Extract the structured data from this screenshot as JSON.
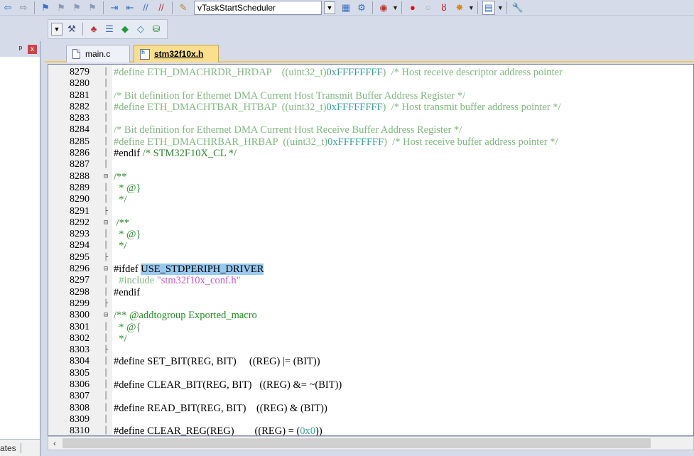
{
  "toolbar_top": {
    "function_combo": "vTaskStartScheduler"
  },
  "left_panel": {
    "pin_glyph": "ᵖ",
    "close_glyph": "x",
    "footer_label": "ates"
  },
  "tabs": [
    {
      "label": "main.c"
    },
    {
      "label": "stm32f10x.h"
    }
  ],
  "code_lines": [
    {
      "n": "8279",
      "fold": "│",
      "code": "#define ETH_DMACHRDR_HRDAP    ((uint32_t)0xFFFFFFFF)  /* Host receive descriptor address pointer"
    },
    {
      "n": "8280",
      "fold": "│",
      "code": ""
    },
    {
      "n": "8281",
      "fold": "│",
      "code": "/* Bit definition for Ethernet DMA Current Host Transmit Buffer Address Register */"
    },
    {
      "n": "8282",
      "fold": "│",
      "code": "#define ETH_DMACHTBAR_HTBAP  ((uint32_t)0xFFFFFFFF)  /* Host transmit buffer address pointer */"
    },
    {
      "n": "8283",
      "fold": "│",
      "code": ""
    },
    {
      "n": "8284",
      "fold": "│",
      "code": "/* Bit definition for Ethernet DMA Current Host Receive Buffer Address Register */"
    },
    {
      "n": "8285",
      "fold": "│",
      "code": "#define ETH_DMACHRBAR_HRBAP  ((uint32_t)0xFFFFFFFF)  /* Host receive buffer address pointer */"
    },
    {
      "n": "8286",
      "fold": "│",
      "code": "#endif /* STM32F10X_CL */"
    },
    {
      "n": "8287",
      "fold": "│",
      "code": ""
    },
    {
      "n": "8288",
      "fold": "⊟",
      "code": "/**"
    },
    {
      "n": "8289",
      "fold": "│",
      "code": "  * @}"
    },
    {
      "n": "8290",
      "fold": "│",
      "code": "  */"
    },
    {
      "n": "8291",
      "fold": "├",
      "code": ""
    },
    {
      "n": "8292",
      "fold": "⊟",
      "code": " /**"
    },
    {
      "n": "8293",
      "fold": "│",
      "code": "  * @}"
    },
    {
      "n": "8294",
      "fold": "│",
      "code": "  */"
    },
    {
      "n": "8295",
      "fold": "├",
      "code": ""
    },
    {
      "n": "8296",
      "fold": "⊟",
      "code": "#ifdef USE_STDPERIPH_DRIVER"
    },
    {
      "n": "8297",
      "fold": "│",
      "code": "  #include \"stm32f10x_conf.h\""
    },
    {
      "n": "8298",
      "fold": "│",
      "code": "#endif"
    },
    {
      "n": "8299",
      "fold": "├",
      "code": ""
    },
    {
      "n": "8300",
      "fold": "⊟",
      "code": "/** @addtogroup Exported_macro"
    },
    {
      "n": "8301",
      "fold": "│",
      "code": "  * @{"
    },
    {
      "n": "8302",
      "fold": "│",
      "code": "  */"
    },
    {
      "n": "8303",
      "fold": "├",
      "code": ""
    },
    {
      "n": "8304",
      "fold": "│",
      "code": "#define SET_BIT(REG, BIT)     ((REG) |= (BIT))"
    },
    {
      "n": "8305",
      "fold": "│",
      "code": ""
    },
    {
      "n": "8306",
      "fold": "│",
      "code": "#define CLEAR_BIT(REG, BIT)   ((REG) &= ~(BIT))"
    },
    {
      "n": "8307",
      "fold": "│",
      "code": ""
    },
    {
      "n": "8308",
      "fold": "│",
      "code": "#define READ_BIT(REG, BIT)    ((REG) & (BIT))"
    },
    {
      "n": "8309",
      "fold": "│",
      "code": ""
    },
    {
      "n": "8310",
      "fold": "│",
      "code": "#define CLEAR_REG(REG)        ((REG) = (0x0))"
    }
  ],
  "highlight": {
    "macro": "USE_STDPERIPH_DRIVER",
    "selection_color": "#99c9ef"
  },
  "colors": {
    "comment": "#3a8a3a",
    "hex": "#3d9e9e",
    "string": "#c55ac5",
    "active_tab": "#fbdf8f"
  }
}
